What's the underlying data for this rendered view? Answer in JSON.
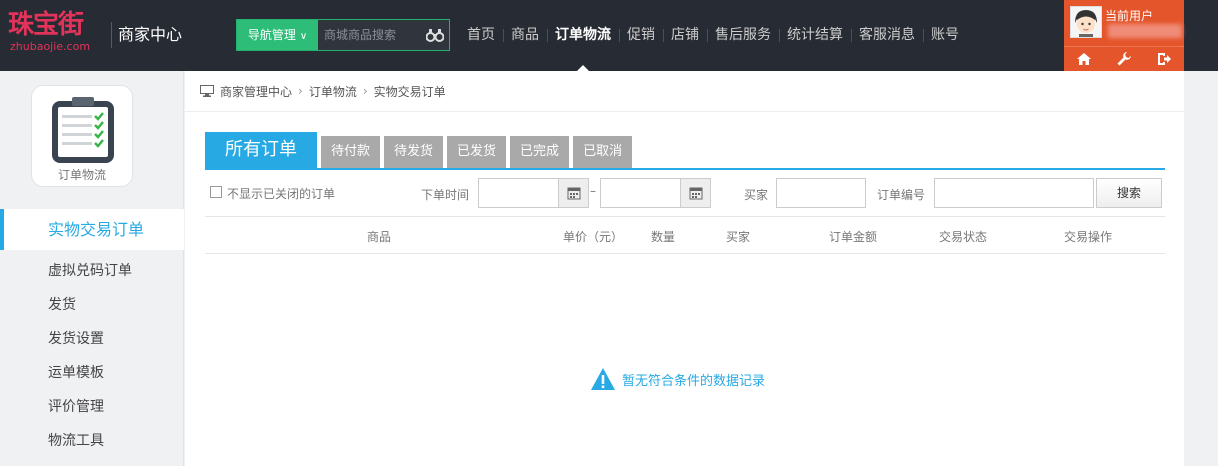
{
  "header": {
    "logo_cn": "珠宝街",
    "logo_en": "zhubaojie.com",
    "site_title": "商家中心",
    "nav_button": "导航管理",
    "search_placeholder": "商城商品搜索",
    "nav_items": [
      "首页",
      "商品",
      "订单物流",
      "促销",
      "店铺",
      "售后服务",
      "统计结算",
      "客服消息",
      "账号"
    ],
    "active_nav": "订单物流",
    "user_label": "当前用户",
    "colors": {
      "header_bg": "#272b33",
      "accent_green": "#2ebd79",
      "user_panel": "#e4552c",
      "logo": "#e2335a"
    },
    "icons": [
      "binoculars-search-icon",
      "home-icon",
      "wrench-icon",
      "logout-icon"
    ]
  },
  "sidebar": {
    "module_label": "订单物流",
    "module_icon": "clipboard-checklist-icon",
    "items": [
      "实物交易订单",
      "虚拟兑码订单",
      "发货",
      "发货设置",
      "运单模板",
      "评价管理",
      "物流工具"
    ],
    "active_item": "实物交易订单"
  },
  "main": {
    "breadcrumb": [
      "商家管理中心",
      "订单物流",
      "实物交易订单"
    ],
    "tabs": [
      "所有订单",
      "待付款",
      "待发货",
      "已发货",
      "已完成",
      "已取消"
    ],
    "active_tab": "所有订单",
    "filters": {
      "hide_closed_label": "不显示已关闭的订单",
      "order_time_label": "下单时间",
      "date_separator": "–",
      "buyer_label": "买家",
      "order_no_label": "订单编号",
      "search_button": "搜索"
    },
    "columns": [
      "商品",
      "单价（元）",
      "数量",
      "买家",
      "订单金额",
      "交易状态",
      "交易操作"
    ],
    "empty_message": "暂无符合条件的数据记录",
    "accent": "#27a9e3"
  }
}
